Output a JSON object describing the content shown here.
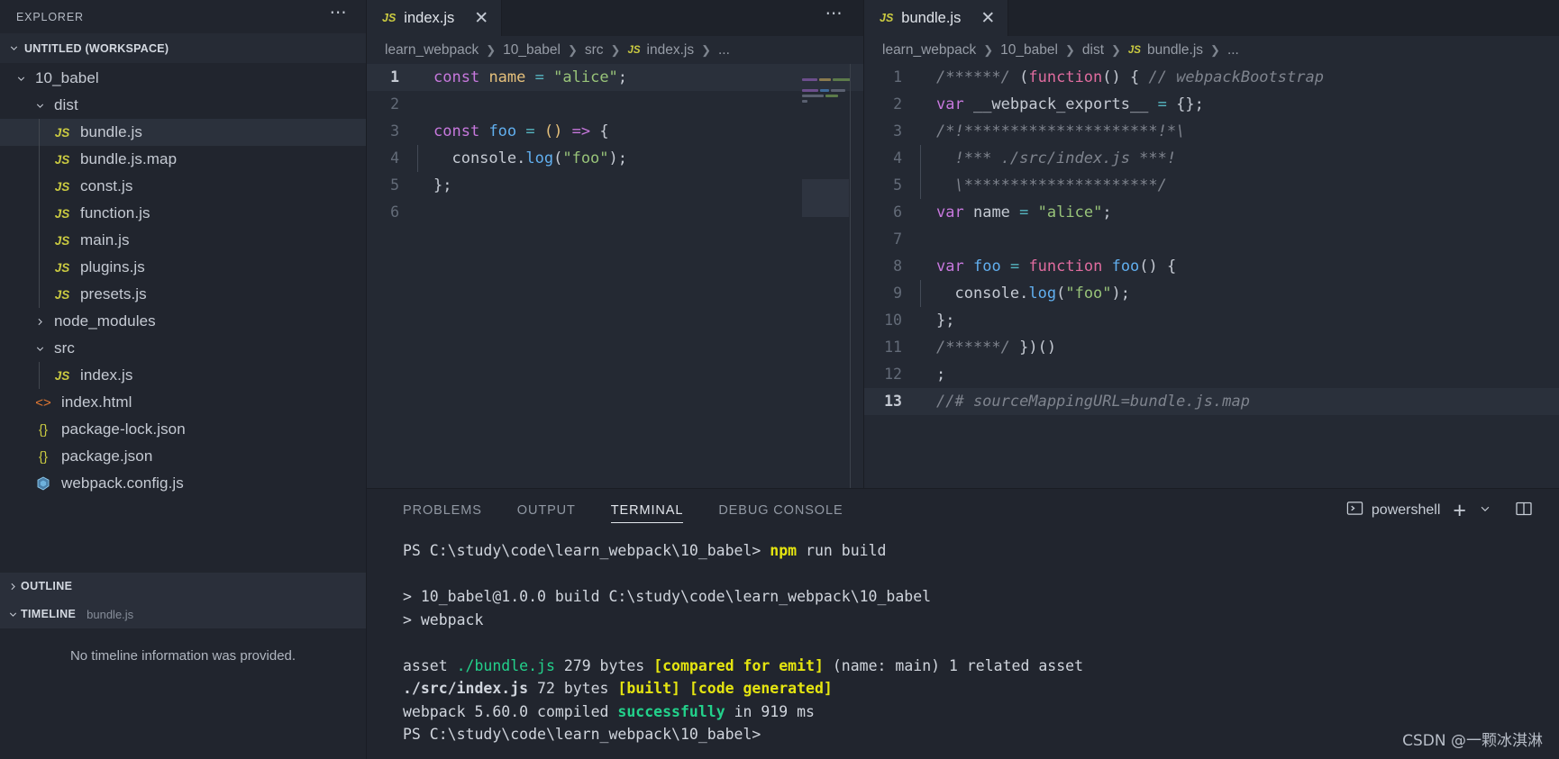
{
  "sidebar": {
    "header_title": "EXPLORER",
    "more_icon": "ellipsis-icon",
    "workspace_label": "UNTITLED (WORKSPACE)",
    "tree": [
      {
        "label": "10_babel",
        "kind": "folder",
        "depth": 1,
        "expanded": true,
        "icon": "chevron-down-icon"
      },
      {
        "label": "dist",
        "kind": "folder",
        "depth": 2,
        "expanded": true,
        "icon": "chevron-down-icon"
      },
      {
        "label": "bundle.js",
        "kind": "js",
        "depth": 3,
        "selected": true,
        "icon": "js-file-icon"
      },
      {
        "label": "bundle.js.map",
        "kind": "js",
        "depth": 3,
        "selected": false,
        "icon": "js-file-icon"
      },
      {
        "label": "const.js",
        "kind": "js",
        "depth": 3,
        "selected": false,
        "icon": "js-file-icon"
      },
      {
        "label": "function.js",
        "kind": "js",
        "depth": 3,
        "selected": false,
        "icon": "js-file-icon"
      },
      {
        "label": "main.js",
        "kind": "js",
        "depth": 3,
        "selected": false,
        "icon": "js-file-icon"
      },
      {
        "label": "plugins.js",
        "kind": "js",
        "depth": 3,
        "selected": false,
        "icon": "js-file-icon"
      },
      {
        "label": "presets.js",
        "kind": "js",
        "depth": 3,
        "selected": false,
        "icon": "js-file-icon"
      },
      {
        "label": "node_modules",
        "kind": "folder",
        "depth": 2,
        "expanded": false,
        "icon": "chevron-right-icon"
      },
      {
        "label": "src",
        "kind": "folder",
        "depth": 2,
        "expanded": true,
        "icon": "chevron-down-icon"
      },
      {
        "label": "index.js",
        "kind": "js",
        "depth": 3,
        "selected": false,
        "icon": "js-file-icon"
      },
      {
        "label": "index.html",
        "kind": "html",
        "depth": 2,
        "selected": false,
        "icon": "html-file-icon"
      },
      {
        "label": "package-lock.json",
        "kind": "json",
        "depth": 2,
        "selected": false,
        "icon": "json-file-icon"
      },
      {
        "label": "package.json",
        "kind": "json",
        "depth": 2,
        "selected": false,
        "icon": "json-file-icon"
      },
      {
        "label": "webpack.config.js",
        "kind": "wp",
        "depth": 2,
        "selected": false,
        "icon": "webpack-file-icon"
      }
    ],
    "outline": {
      "label": "OUTLINE",
      "icon": "chevron-right-icon"
    },
    "timeline": {
      "label": "TIMELINE",
      "sub": "bundle.js",
      "icon": "chevron-down-icon",
      "empty_message": "No timeline information was provided."
    }
  },
  "editor_left": {
    "more_icon": "ellipsis-icon",
    "tab": {
      "label": "index.js",
      "icon": "js-file-icon",
      "close_icon": "close-icon"
    },
    "breadcrumb": [
      "learn_webpack",
      "10_babel",
      "src",
      "index.js",
      "..."
    ],
    "breadcrumb_file_icon": "js-file-icon",
    "lines": [
      {
        "n": "1",
        "active": true,
        "tokens": [
          {
            "t": "const",
            "c": "t-kw"
          },
          {
            "t": " ",
            "c": "t-plain"
          },
          {
            "t": "name",
            "c": "t-var"
          },
          {
            "t": " ",
            "c": "t-plain"
          },
          {
            "t": "=",
            "c": "t-op"
          },
          {
            "t": " ",
            "c": "t-plain"
          },
          {
            "t": "\"alice\"",
            "c": "t-str"
          },
          {
            "t": ";",
            "c": "t-punct"
          }
        ]
      },
      {
        "n": "2",
        "active": false,
        "tokens": []
      },
      {
        "n": "3",
        "active": false,
        "tokens": [
          {
            "t": "const",
            "c": "t-kw"
          },
          {
            "t": " ",
            "c": "t-plain"
          },
          {
            "t": "foo",
            "c": "t-fn"
          },
          {
            "t": " ",
            "c": "t-plain"
          },
          {
            "t": "=",
            "c": "t-op"
          },
          {
            "t": " ",
            "c": "t-plain"
          },
          {
            "t": "()",
            "c": "t-var"
          },
          {
            "t": " ",
            "c": "t-plain"
          },
          {
            "t": "=>",
            "c": "t-arrow"
          },
          {
            "t": " ",
            "c": "t-plain"
          },
          {
            "t": "{",
            "c": "t-punct"
          }
        ]
      },
      {
        "n": "4",
        "active": false,
        "indent": true,
        "tokens": [
          {
            "t": "  console",
            "c": "t-plain"
          },
          {
            "t": ".",
            "c": "t-punct"
          },
          {
            "t": "log",
            "c": "t-fn"
          },
          {
            "t": "(",
            "c": "t-punct"
          },
          {
            "t": "\"foo\"",
            "c": "t-str"
          },
          {
            "t": ");",
            "c": "t-punct"
          }
        ]
      },
      {
        "n": "5",
        "active": false,
        "tokens": [
          {
            "t": "};",
            "c": "t-punct"
          }
        ]
      },
      {
        "n": "6",
        "active": false,
        "tokens": []
      }
    ]
  },
  "editor_right": {
    "more_icon": "ellipsis-icon",
    "tab": {
      "label": "bundle.js",
      "icon": "js-file-icon",
      "close_icon": "close-icon"
    },
    "breadcrumb": [
      "learn_webpack",
      "10_babel",
      "dist",
      "bundle.js",
      "..."
    ],
    "breadcrumb_file_icon": "js-file-icon",
    "lines": [
      {
        "n": "1",
        "active": false,
        "tokens": [
          {
            "t": "/******/",
            "c": "t-cmt"
          },
          {
            "t": " ",
            "c": "t-plain"
          },
          {
            "t": "(",
            "c": "t-punct"
          },
          {
            "t": "function",
            "c": "t-pink"
          },
          {
            "t": "()",
            "c": "t-punct"
          },
          {
            "t": " { ",
            "c": "t-punct"
          },
          {
            "t": "// webpackBootstrap",
            "c": "t-cmt"
          }
        ]
      },
      {
        "n": "2",
        "active": false,
        "tokens": [
          {
            "t": "var",
            "c": "t-kw"
          },
          {
            "t": " __webpack_exports__ ",
            "c": "t-plain"
          },
          {
            "t": "=",
            "c": "t-op"
          },
          {
            "t": " {};",
            "c": "t-punct"
          }
        ]
      },
      {
        "n": "3",
        "active": false,
        "tokens": [
          {
            "t": "/*!*********************!*\\",
            "c": "t-cmt"
          }
        ]
      },
      {
        "n": "4",
        "active": false,
        "indent": true,
        "tokens": [
          {
            "t": "  !*** ./src/index.js ***!",
            "c": "t-cmt"
          }
        ]
      },
      {
        "n": "5",
        "active": false,
        "indent": true,
        "tokens": [
          {
            "t": "  \\*********************/",
            "c": "t-cmt"
          }
        ]
      },
      {
        "n": "6",
        "active": false,
        "tokens": [
          {
            "t": "var",
            "c": "t-kw"
          },
          {
            "t": " ",
            "c": "t-plain"
          },
          {
            "t": "name",
            "c": "t-plain"
          },
          {
            "t": " ",
            "c": "t-plain"
          },
          {
            "t": "=",
            "c": "t-op"
          },
          {
            "t": " ",
            "c": "t-plain"
          },
          {
            "t": "\"alice\"",
            "c": "t-str"
          },
          {
            "t": ";",
            "c": "t-punct"
          }
        ]
      },
      {
        "n": "7",
        "active": false,
        "tokens": []
      },
      {
        "n": "8",
        "active": false,
        "tokens": [
          {
            "t": "var",
            "c": "t-kw"
          },
          {
            "t": " ",
            "c": "t-plain"
          },
          {
            "t": "foo",
            "c": "t-fn"
          },
          {
            "t": " ",
            "c": "t-plain"
          },
          {
            "t": "=",
            "c": "t-op"
          },
          {
            "t": " ",
            "c": "t-plain"
          },
          {
            "t": "function",
            "c": "t-pink"
          },
          {
            "t": " ",
            "c": "t-plain"
          },
          {
            "t": "foo",
            "c": "t-fn"
          },
          {
            "t": "()",
            "c": "t-punct"
          },
          {
            "t": " {",
            "c": "t-punct"
          }
        ]
      },
      {
        "n": "9",
        "active": false,
        "indent": true,
        "tokens": [
          {
            "t": "  console",
            "c": "t-plain"
          },
          {
            "t": ".",
            "c": "t-punct"
          },
          {
            "t": "log",
            "c": "t-fn"
          },
          {
            "t": "(",
            "c": "t-punct"
          },
          {
            "t": "\"foo\"",
            "c": "t-str"
          },
          {
            "t": ");",
            "c": "t-punct"
          }
        ]
      },
      {
        "n": "10",
        "active": false,
        "tokens": [
          {
            "t": "};",
            "c": "t-punct"
          }
        ]
      },
      {
        "n": "11",
        "active": false,
        "tokens": [
          {
            "t": "/******/",
            "c": "t-cmt"
          },
          {
            "t": " })()",
            "c": "t-punct"
          }
        ]
      },
      {
        "n": "12",
        "active": false,
        "tokens": [
          {
            "t": ";",
            "c": "t-punct"
          }
        ]
      },
      {
        "n": "13",
        "active": true,
        "tokens": [
          {
            "t": "//# sourceMappingURL=bundle.js.map",
            "c": "t-cmt"
          }
        ]
      }
    ]
  },
  "panel": {
    "tabs": [
      {
        "label": "PROBLEMS",
        "active": false
      },
      {
        "label": "OUTPUT",
        "active": false
      },
      {
        "label": "TERMINAL",
        "active": true
      },
      {
        "label": "DEBUG CONSOLE",
        "active": false
      }
    ],
    "shell_name": "powershell",
    "shell_icon": "terminal-icon",
    "new_terminal_icon": "plus-icon",
    "dropdown_icon": "chevron-down-icon",
    "split_icon": "split-panel-icon",
    "terminal_lines": [
      {
        "segs": [
          {
            "t": "PS C:\\study\\code\\learn_webpack\\10_babel> ",
            "c": "tm-white"
          },
          {
            "t": "npm",
            "c": "tm-yellow"
          },
          {
            "t": " run build",
            "c": "tm-white"
          }
        ]
      },
      {
        "segs": []
      },
      {
        "segs": [
          {
            "t": "> 10_babel@1.0.0 build C:\\study\\code\\learn_webpack\\10_babel",
            "c": "tm-white"
          }
        ]
      },
      {
        "segs": [
          {
            "t": "> webpack",
            "c": "tm-white"
          }
        ]
      },
      {
        "segs": []
      },
      {
        "segs": [
          {
            "t": "asset ",
            "c": "tm-white"
          },
          {
            "t": "./bundle.js",
            "c": "tm-green-b"
          },
          {
            "t": " 279 bytes ",
            "c": "tm-white"
          },
          {
            "t": "[compared for emit]",
            "c": "tm-yellow"
          },
          {
            "t": " (name: main) 1 related asset",
            "c": "tm-white"
          }
        ]
      },
      {
        "segs": [
          {
            "t": "./src/index.js",
            "c": "tm-bold"
          },
          {
            "t": " 72 bytes ",
            "c": "tm-white"
          },
          {
            "t": "[built] [code generated]",
            "c": "tm-yellow"
          }
        ]
      },
      {
        "segs": [
          {
            "t": "webpack 5.60.0 compiled ",
            "c": "tm-white"
          },
          {
            "t": "successfully",
            "c": "tm-green"
          },
          {
            "t": " in 919 ms",
            "c": "tm-white"
          }
        ]
      },
      {
        "segs": [
          {
            "t": "PS C:\\study\\code\\learn_webpack\\10_babel>",
            "c": "tm-white"
          }
        ]
      }
    ]
  },
  "watermark": {
    "text": "CSDN @一颗冰淇淋"
  }
}
